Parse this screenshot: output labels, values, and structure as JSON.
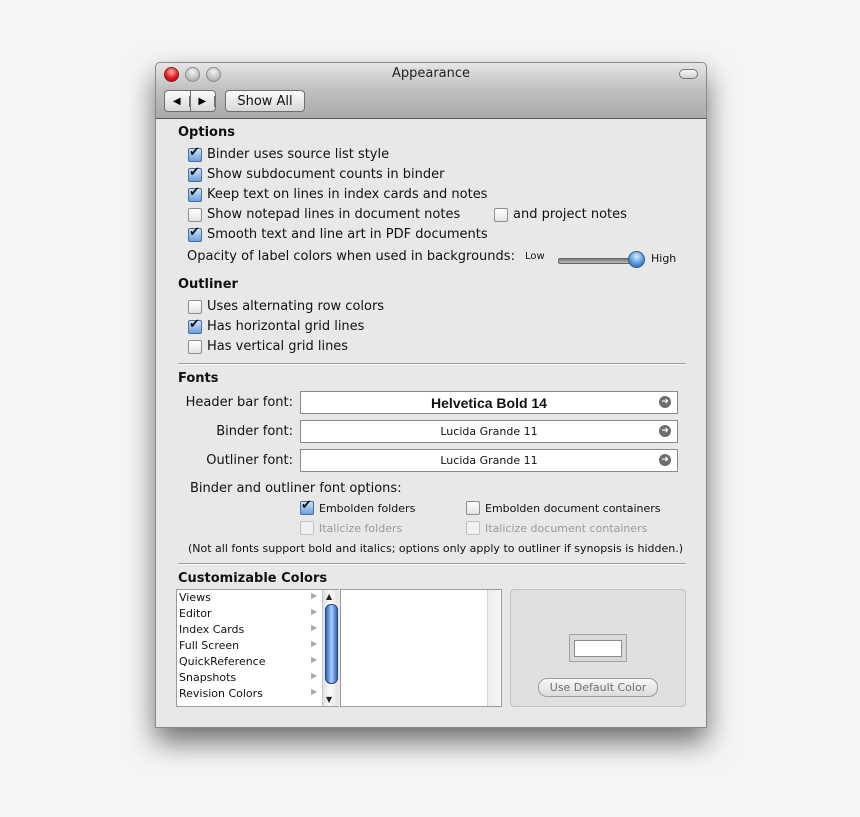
{
  "window": {
    "title": "Appearance",
    "toolbar": {
      "back_glyph": "◀",
      "forward_glyph": "▶",
      "show_all_label": "Show All"
    }
  },
  "options": {
    "heading": "Options",
    "checkboxes": [
      {
        "label": "Binder uses source list style",
        "checked": true
      },
      {
        "label": "Show subdocument counts in binder",
        "checked": true
      },
      {
        "label": "Keep text on lines in index cards and notes",
        "checked": true
      },
      {
        "label": "Show notepad lines in document notes",
        "checked": false
      },
      {
        "label": "Smooth text and line art in PDF documents",
        "checked": true
      }
    ],
    "project_notes": {
      "label": "and project notes",
      "checked": false
    },
    "opacity": {
      "label": "Opacity of label colors when used in backgrounds:",
      "low_label": "Low",
      "high_label": "High",
      "value_fraction": 1.0
    }
  },
  "outliner": {
    "heading": "Outliner",
    "checkboxes": [
      {
        "label": "Uses alternating row colors",
        "checked": false
      },
      {
        "label": "Has horizontal grid lines",
        "checked": true
      },
      {
        "label": "Has vertical grid lines",
        "checked": false
      }
    ]
  },
  "fonts": {
    "heading": "Fonts",
    "fields": [
      {
        "label": "Header bar font:",
        "value": "Helvetica Bold 14"
      },
      {
        "label": "Binder font:",
        "value": "Lucida Grande 11"
      },
      {
        "label": "Outliner font:",
        "value": "Lucida Grande 11"
      }
    ],
    "options_label": "Binder and outliner font options:",
    "font_options": [
      {
        "label": "Embolden folders",
        "checked": true,
        "enabled": true
      },
      {
        "label": "Embolden document containers",
        "checked": false,
        "enabled": true
      },
      {
        "label": "Italicize folders",
        "checked": false,
        "enabled": false
      },
      {
        "label": "Italicize document containers",
        "checked": false,
        "enabled": false
      }
    ],
    "note": "(Not all fonts support bold and italics; options only apply to outliner if synopsis is hidden.)"
  },
  "colors": {
    "heading": "Customizable Colors",
    "categories": [
      "Views",
      "Editor",
      "Index Cards",
      "Full Screen",
      "QuickReference",
      "Snapshots",
      "Revision Colors"
    ],
    "default_button_label": "Use Default Color",
    "well_color": "#ffffff"
  }
}
